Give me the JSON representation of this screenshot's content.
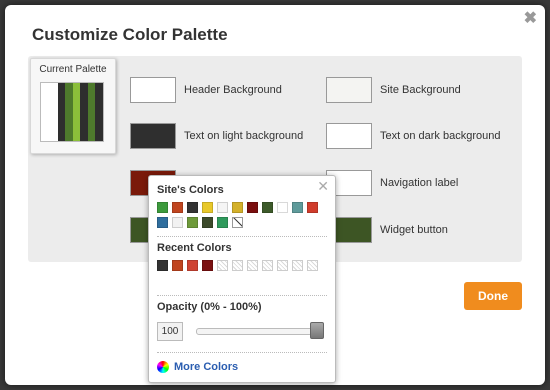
{
  "modal": {
    "title": "Customize Color Palette",
    "close_glyph": "✖"
  },
  "current_palette": {
    "label": "Current Palette",
    "stripes": [
      "#ffffff",
      "#2e2e2e",
      "#4e7a2c",
      "#8bbf3a",
      "#2e2e2e",
      "#4e7a2c",
      "#2e2e2e"
    ]
  },
  "color_rows": [
    {
      "label": "Header Background",
      "color": "#ffffff"
    },
    {
      "label": "Site Background",
      "color": "#f4f4f2"
    },
    {
      "label": "Text on light background",
      "color": "#2f2f2f"
    },
    {
      "label": "Text on dark background",
      "color": "#ffffff"
    },
    {
      "label": "Navigation label",
      "color": "#ffffff"
    },
    {
      "label": "Widget button",
      "color": "#3d5524"
    },
    {
      "label": "",
      "color": "#7a1a0a"
    },
    {
      "label": "",
      "color": "#3d5524"
    }
  ],
  "done_label": "Done",
  "popover": {
    "close_glyph": "✕",
    "sites_colors_title": "Site's Colors",
    "sites_colors": [
      "#3c9a3c",
      "#c0451f",
      "#333333",
      "#e8c82a",
      "#f5f5f5",
      "#d4b12b",
      "#7a0e0e",
      "#3d5a2a",
      "#ffffff",
      "#5f9b9b",
      "#d03c2c",
      "#2f6e9e",
      "#f2f2f2",
      "#6e9a3a",
      "#3c4a2a",
      "#2f9a5c",
      "none"
    ],
    "recent_colors_title": "Recent Colors",
    "recent_colors": [
      "#333333",
      "#c0451f",
      "#cf4433",
      "#7a1010",
      "empty",
      "empty",
      "empty",
      "empty",
      "empty",
      "empty",
      "empty"
    ],
    "opacity_title": "Opacity (0% - 100%)",
    "opacity_value": "100",
    "opacity_fraction": 1.0,
    "more_colors_label": "More Colors"
  }
}
